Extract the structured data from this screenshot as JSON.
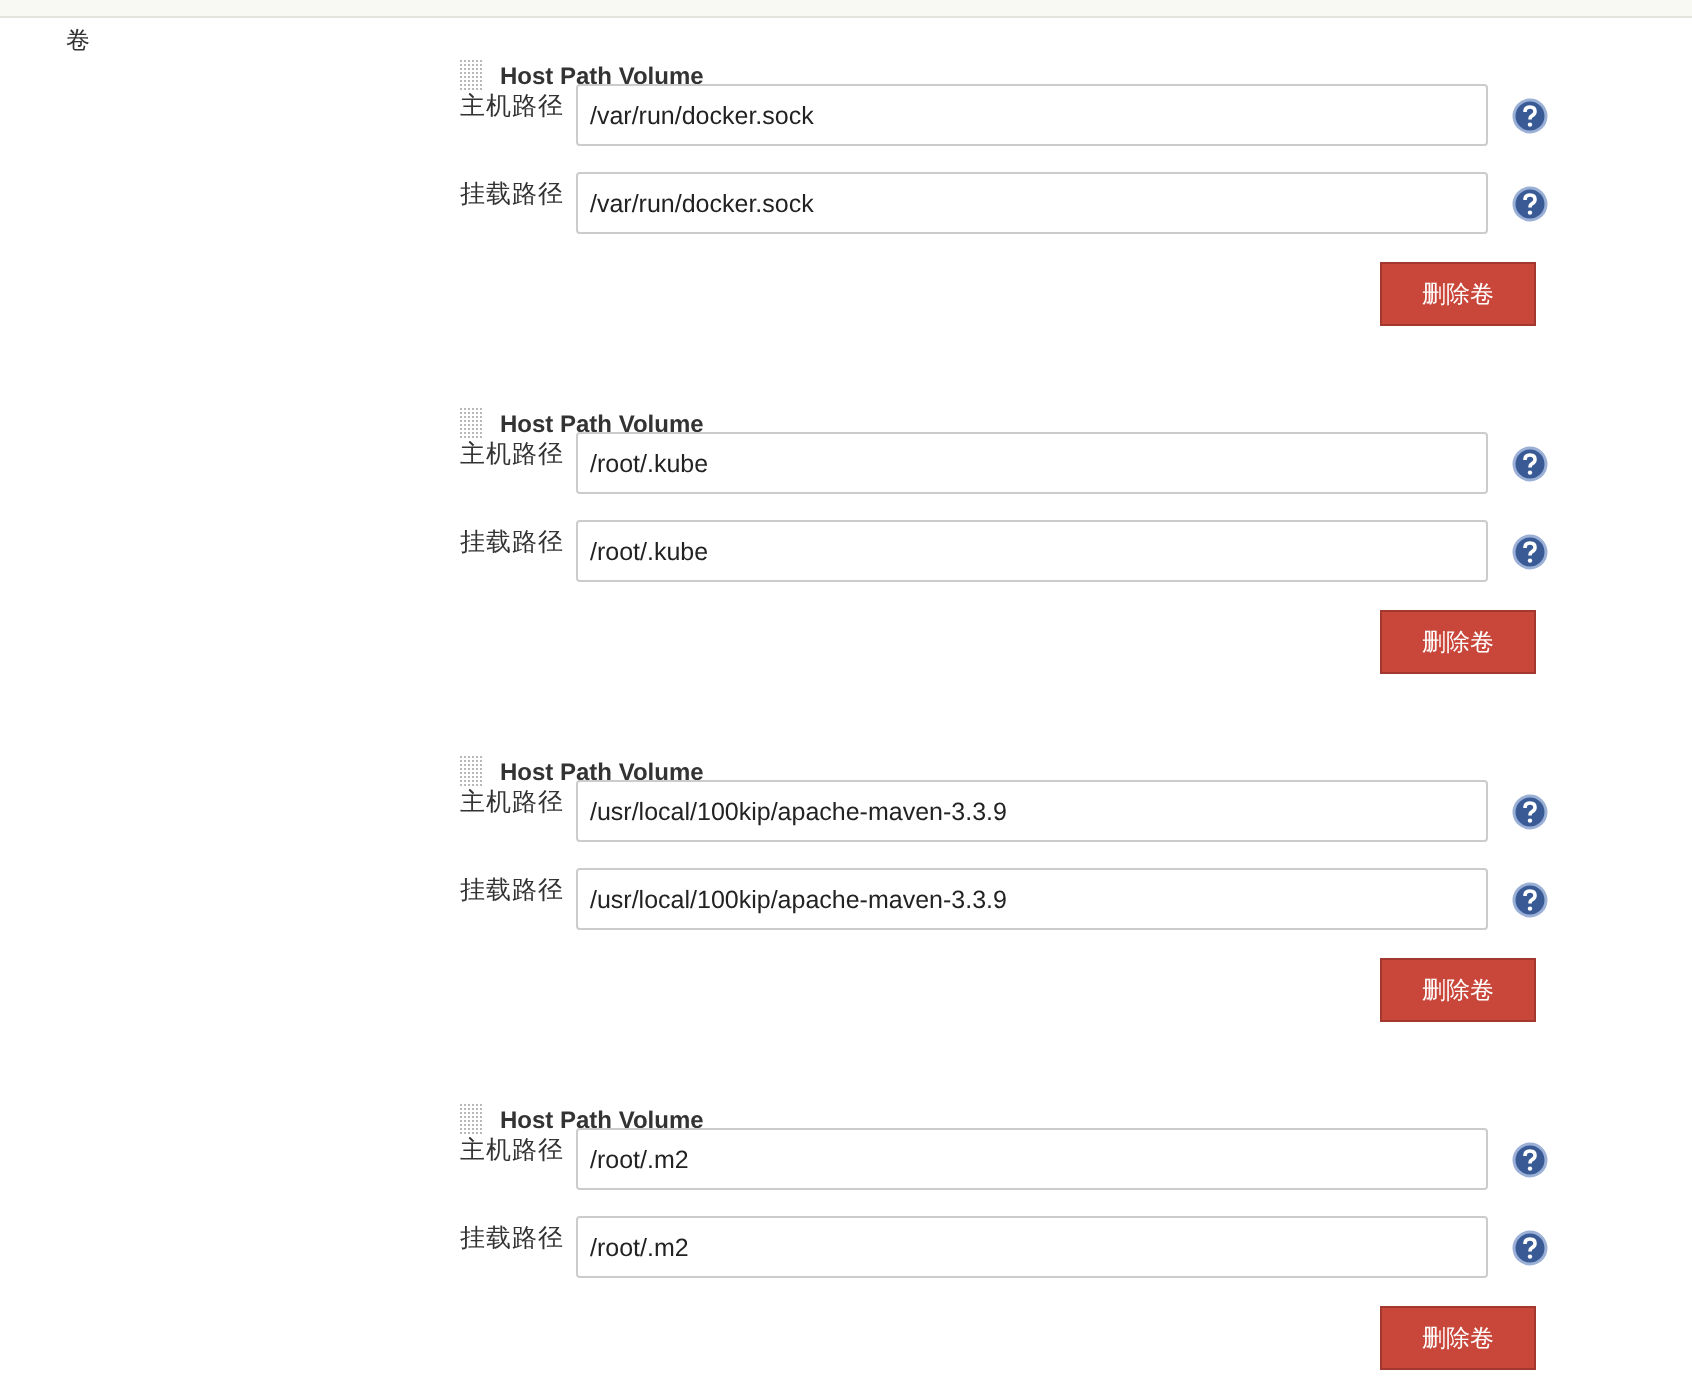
{
  "section_label": "卷",
  "volumes": [
    {
      "title": "Host Path Volume",
      "fields": [
        {
          "label": "主机路径",
          "value": "/var/run/docker.sock"
        },
        {
          "label": "挂载路径",
          "value": "/var/run/docker.sock"
        }
      ],
      "delete_button": "删除卷"
    },
    {
      "title": "Host Path Volume",
      "fields": [
        {
          "label": "主机路径",
          "value": "/root/.kube"
        },
        {
          "label": "挂载路径",
          "value": "/root/.kube"
        }
      ],
      "delete_button": "删除卷"
    },
    {
      "title": "Host Path Volume",
      "fields": [
        {
          "label": "主机路径",
          "value": "/usr/local/100kip/apache-maven-3.3.9"
        },
        {
          "label": "挂载路径",
          "value": "/usr/local/100kip/apache-maven-3.3.9"
        }
      ],
      "delete_button": "删除卷"
    },
    {
      "title": "Host Path Volume",
      "fields": [
        {
          "label": "主机路径",
          "value": "/root/.m2"
        },
        {
          "label": "挂载路径",
          "value": "/root/.m2"
        }
      ],
      "delete_button": "删除卷"
    }
  ]
}
